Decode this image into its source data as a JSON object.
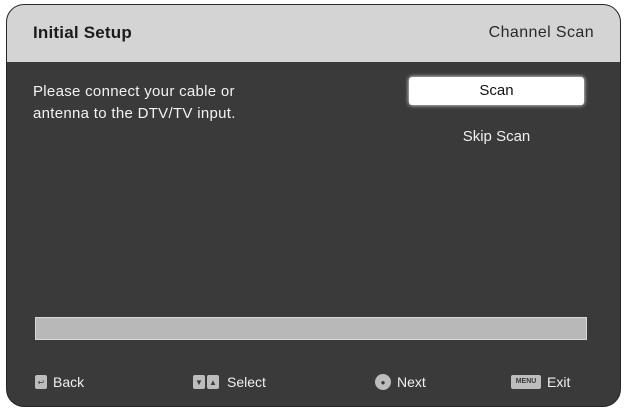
{
  "header": {
    "title": "Initial Setup",
    "section": "Channel Scan"
  },
  "message": {
    "line1": "Please connect your cable or",
    "line2": "antenna to the DTV/TV input."
  },
  "menu": {
    "items": [
      {
        "label": "Scan",
        "selected": true
      },
      {
        "label": "Skip Scan",
        "selected": false
      }
    ]
  },
  "progress": {
    "fraction": 0.0
  },
  "footer": {
    "back_label": "Back",
    "select_label": "Select",
    "next_label": "Next",
    "exit_label": "Exit",
    "menu_key_label": "MENU"
  },
  "colors": {
    "panel": "#3a3a3a",
    "header": "#d4d4d4",
    "highlight": "#ffffff"
  },
  "icons": {
    "back": "return-key-icon",
    "select": "up-down-arrow-keys-icon",
    "next": "enter-key-icon",
    "exit": "menu-key-icon"
  }
}
